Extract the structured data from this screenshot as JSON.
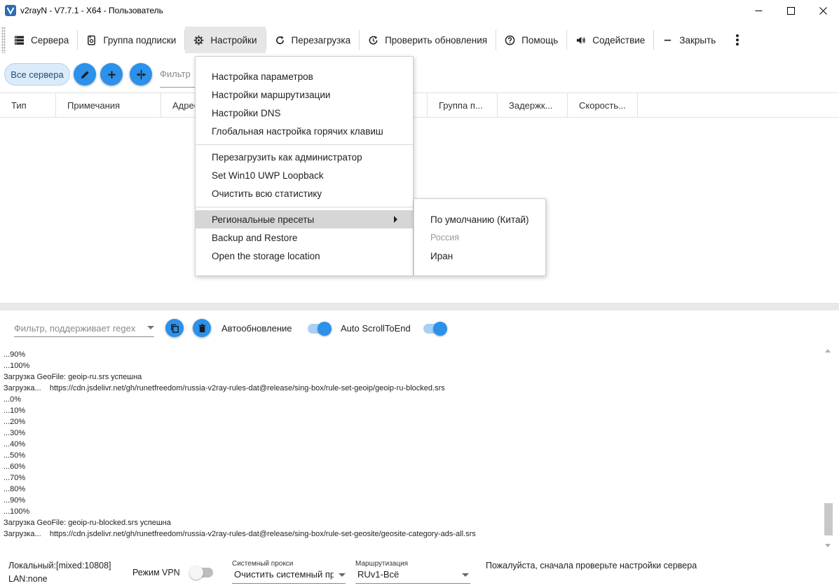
{
  "window": {
    "title": "v2rayN - V7.7.1 - X64 - Пользователь"
  },
  "toolbar": {
    "servers": "Сервера",
    "subscription_group": "Группа подписки",
    "settings": "Настройки",
    "reload": "Перезагрузка",
    "check_updates": "Проверить обновления",
    "help": "Помощь",
    "promotion": "Содействие",
    "close": "Закрыть"
  },
  "filterbar": {
    "all_servers": "Все сервера",
    "filter_placeholder": "Фильтр"
  },
  "grid": {
    "columns": [
      "Тип",
      "Примечания",
      "Адрес",
      "Группа п...",
      "Задержк...",
      "Скорость..."
    ]
  },
  "settings_menu": {
    "items": [
      "Настройка параметров",
      "Настройки маршрутизации",
      "Настройки DNS",
      "Глобальная настройка горячих клавиш"
    ],
    "items2": [
      "Перезагрузить как администратор",
      "Set Win10 UWP Loopback",
      "Очистить всю статистику"
    ],
    "items3": [
      "Региональные пресеты",
      "Backup and Restore",
      "Open the storage location"
    ]
  },
  "regional_submenu": {
    "items": [
      "По умолчанию (Китай)",
      "Россия",
      "Иран"
    ]
  },
  "logbar": {
    "filter_placeholder": "Фильтр, поддерживает regex",
    "auto_refresh_label": "Автообновление",
    "auto_refresh_on": true,
    "auto_scroll_label": "Auto ScrollToEnd",
    "auto_scroll_on": true
  },
  "log": {
    "lines": [
      "...90%",
      "...100%",
      "Загрузка GeoFile: geoip-ru.srs успешна",
      "Загрузка...    https://cdn.jsdelivr.net/gh/runetfreedom/russia-v2ray-rules-dat@release/sing-box/rule-set-geoip/geoip-ru-blocked.srs",
      "...0%",
      "...10%",
      "...20%",
      "...30%",
      "...40%",
      "...50%",
      "...60%",
      "...70%",
      "...80%",
      "...90%",
      "...100%",
      "Загрузка GeoFile: geoip-ru-blocked.srs успешна",
      "Загрузка...    https://cdn.jsdelivr.net/gh/runetfreedom/russia-v2ray-rules-dat@release/sing-box/rule-set-geosite/geosite-category-ads-all.srs"
    ]
  },
  "status": {
    "local": "Локальный:[mixed:10808]",
    "lan": "LAN:none",
    "vpn_label": "Режим VPN",
    "vpn_on": false,
    "sysproxy_label": "Системный прокси",
    "sysproxy_value": "Очистить системный прокси",
    "routing_label": "Маршрутизация",
    "routing_value": "RUv1-Всё",
    "message": "Пожалуйста, сначала проверьте настройки сервера"
  },
  "colors": {
    "accent": "#2B91EA",
    "menu_highlight": "#D6D6D6"
  }
}
